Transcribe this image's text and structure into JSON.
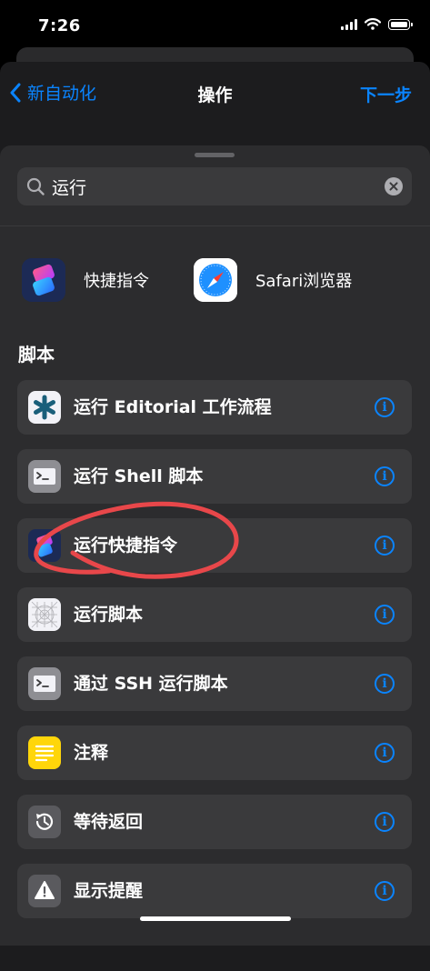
{
  "status_bar": {
    "time": "7:26"
  },
  "nav": {
    "back_label": "新自动化",
    "title": "操作",
    "next_label": "下一步"
  },
  "search": {
    "value": "运行",
    "placeholder": ""
  },
  "apps": [
    {
      "label": "快捷指令",
      "icon": "shortcuts-app-icon"
    },
    {
      "label": "Safari浏览器",
      "icon": "safari-app-icon"
    }
  ],
  "section": {
    "title": "脚本"
  },
  "actions": [
    {
      "label": "运行 Editorial 工作流程",
      "icon": "editorial-asterisk-icon"
    },
    {
      "label": "运行 Shell 脚本",
      "icon": "terminal-icon"
    },
    {
      "label": "运行快捷指令",
      "icon": "shortcuts-icon"
    },
    {
      "label": "运行脚本",
      "icon": "script-grid-icon"
    },
    {
      "label": "通过 SSH 运行脚本",
      "icon": "terminal-icon"
    },
    {
      "label": "注释",
      "icon": "note-lines-icon"
    },
    {
      "label": "等待返回",
      "icon": "clock-return-icon"
    },
    {
      "label": "显示提醒",
      "icon": "warning-triangle-icon"
    }
  ],
  "colors": {
    "accent": "#0a84ff",
    "annotation": "#e8474a",
    "row_bg": "#3a3a3c",
    "sheet_bg": "#2c2c2e"
  }
}
